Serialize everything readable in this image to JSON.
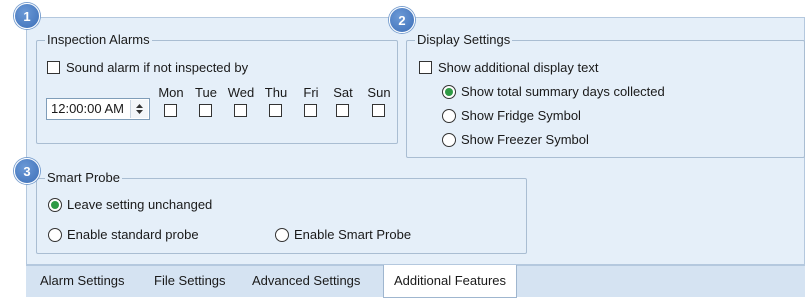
{
  "badges": [
    "1",
    "2",
    "3"
  ],
  "inspection_alarms": {
    "title": "Inspection Alarms",
    "sound_alarm_label": "Sound alarm if not inspected by",
    "time_value": "12:00:00 AM",
    "days": [
      "Mon",
      "Tue",
      "Wed",
      "Thu",
      "Fri",
      "Sat",
      "Sun"
    ]
  },
  "display_settings": {
    "title": "Display Settings",
    "show_additional_label": "Show additional display text",
    "options": [
      "Show total summary days collected",
      "Show Fridge Symbol",
      "Show Freezer Symbol"
    ],
    "selected": "Show total summary days collected"
  },
  "smart_probe": {
    "title": "Smart Probe",
    "options": [
      "Leave setting unchanged",
      "Enable standard probe",
      "Enable Smart Probe"
    ],
    "selected": "Leave setting unchanged"
  },
  "tabs": [
    "Alarm Settings",
    "File Settings",
    "Advanced Settings",
    "Additional Features"
  ],
  "active_tab": "Additional Features",
  "colors": {
    "badge": "#4a7cc4",
    "panel": "#e5eff9",
    "radio_selected": "#2f9a45"
  }
}
